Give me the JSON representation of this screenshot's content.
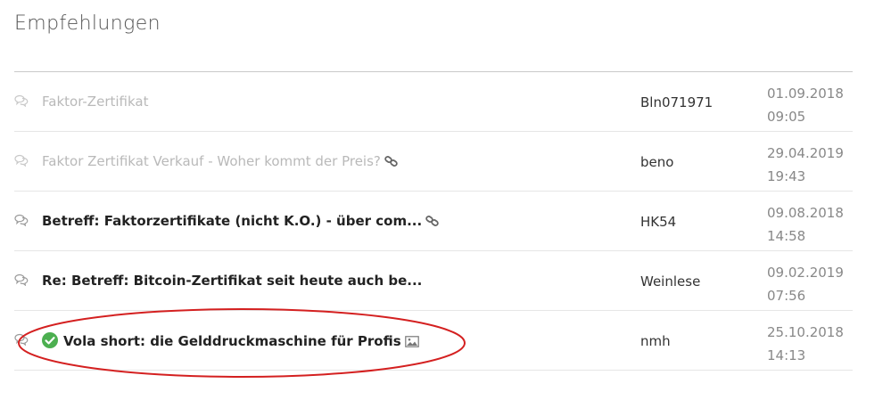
{
  "heading": "Empfehlungen",
  "rows": [
    {
      "title": "Faktor-Zertifikat",
      "author": "Bln071971",
      "date": "01.09.2018",
      "time": "09:05",
      "read": true
    },
    {
      "title": "Faktor Zertifikat Verkauf - Woher kommt der Preis?",
      "author": "beno",
      "date": "29.04.2019",
      "time": "19:43",
      "read": true
    },
    {
      "title": "Betreff: Faktorzertifikate (nicht K.O.) - über com...",
      "author": "HK54",
      "date": "09.08.2018",
      "time": "14:58",
      "read": false
    },
    {
      "title": "Re: Betreff: Bitcoin-Zertifikat seit heute auch be...",
      "author": "Weinlese",
      "date": "09.02.2019",
      "time": "07:56",
      "read": false
    },
    {
      "title": "Vola short: die Gelddruckmaschine für Profis",
      "author": "nmh",
      "date": "25.10.2018",
      "time": "14:13",
      "read": false
    }
  ],
  "colors": {
    "highlight_ellipse": "#d42020",
    "check": "#4caf50"
  }
}
